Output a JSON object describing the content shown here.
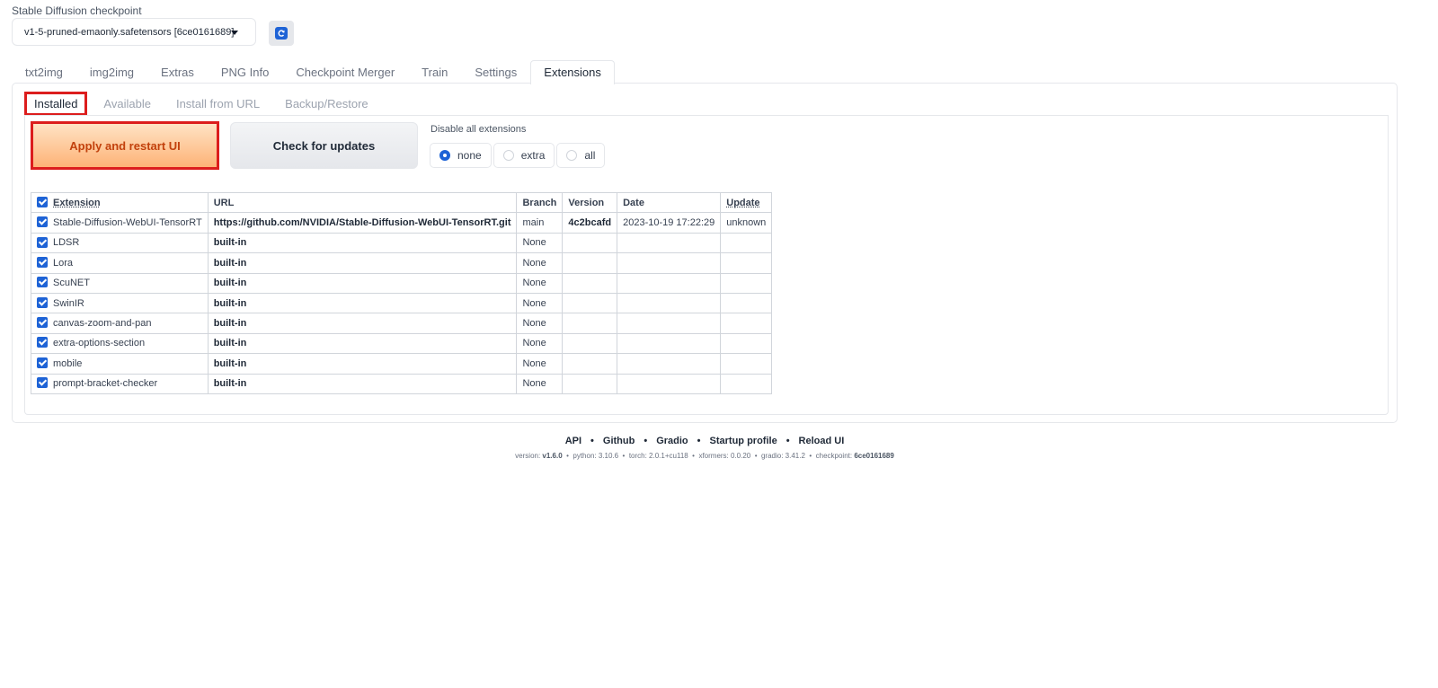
{
  "checkpoint": {
    "label": "Stable Diffusion checkpoint",
    "value": "v1-5-pruned-emaonly.safetensors [6ce0161689]"
  },
  "main_tabs": [
    {
      "label": "txt2img"
    },
    {
      "label": "img2img"
    },
    {
      "label": "Extras"
    },
    {
      "label": "PNG Info"
    },
    {
      "label": "Checkpoint Merger"
    },
    {
      "label": "Train"
    },
    {
      "label": "Settings"
    },
    {
      "label": "Extensions"
    }
  ],
  "sub_tabs": [
    {
      "label": "Installed"
    },
    {
      "label": "Available"
    },
    {
      "label": "Install from URL"
    },
    {
      "label": "Backup/Restore"
    }
  ],
  "buttons": {
    "apply": "Apply and restart UI",
    "check": "Check for updates"
  },
  "disable": {
    "label": "Disable all extensions",
    "options": [
      "none",
      "extra",
      "all"
    ],
    "selected": "none"
  },
  "table": {
    "headers": [
      "Extension",
      "URL",
      "Branch",
      "Version",
      "Date",
      "Update"
    ],
    "rows": [
      {
        "name": "Stable-Diffusion-WebUI-TensorRT",
        "url": "https://github.com/NVIDIA/Stable-Diffusion-WebUI-TensorRT.git",
        "branch": "main",
        "version": "4c2bcafd",
        "date": "2023-10-19 17:22:29",
        "update": "unknown"
      },
      {
        "name": "LDSR",
        "url": "built-in",
        "branch": "None",
        "version": "",
        "date": "",
        "update": ""
      },
      {
        "name": "Lora",
        "url": "built-in",
        "branch": "None",
        "version": "",
        "date": "",
        "update": ""
      },
      {
        "name": "ScuNET",
        "url": "built-in",
        "branch": "None",
        "version": "",
        "date": "",
        "update": ""
      },
      {
        "name": "SwinIR",
        "url": "built-in",
        "branch": "None",
        "version": "",
        "date": "",
        "update": ""
      },
      {
        "name": "canvas-zoom-and-pan",
        "url": "built-in",
        "branch": "None",
        "version": "",
        "date": "",
        "update": ""
      },
      {
        "name": "extra-options-section",
        "url": "built-in",
        "branch": "None",
        "version": "",
        "date": "",
        "update": ""
      },
      {
        "name": "mobile",
        "url": "built-in",
        "branch": "None",
        "version": "",
        "date": "",
        "update": ""
      },
      {
        "name": "prompt-bracket-checker",
        "url": "built-in",
        "branch": "None",
        "version": "",
        "date": "",
        "update": ""
      }
    ]
  },
  "footer": {
    "links": [
      "API",
      "Github",
      "Gradio",
      "Startup profile",
      "Reload UI"
    ],
    "separator": "•",
    "versions": [
      {
        "label": "version: ",
        "value": "v1.6.0"
      },
      {
        "label": "python: ",
        "value": "3.10.6"
      },
      {
        "label": "torch: ",
        "value": "2.0.1+cu118"
      },
      {
        "label": "xformers: ",
        "value": "0.0.20"
      },
      {
        "label": "gradio: ",
        "value": "3.41.2"
      },
      {
        "label": "checkpoint: ",
        "value": "6ce0161689"
      }
    ]
  },
  "colors": {
    "accent": "#1e63d6",
    "highlight": "#dc1d1d",
    "apply_text": "#c2410c"
  },
  "icons": {
    "refresh": "refresh-icon",
    "dropdown": "chevron-down-icon",
    "checkbox": "checkbox-checked-icon"
  }
}
